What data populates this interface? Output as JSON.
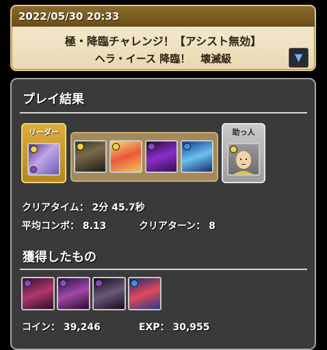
{
  "header": {
    "datetime": "2022/05/30 20:33",
    "title": "極・降臨チャレンジ！【アシスト無効】",
    "subtitle": "ヘラ・イース 降臨！　壊滅級",
    "dropdown_icon": "triangle-down-icon"
  },
  "result": {
    "section_title": "プレイ結果",
    "leader_label": "リーダー",
    "helper_label": "助っ人",
    "clear_time_label": "クリアタイム：",
    "clear_time": "2分 45.7秒",
    "avg_combo_label": "平均コンボ：",
    "avg_combo": "8.13",
    "clear_turns_label": "クリアターン：",
    "clear_turns": "8"
  },
  "team": {
    "leader": {
      "name": "leader-monster",
      "attr_color": "#f0d23a",
      "sub_color": "#8a46c8"
    },
    "subs": [
      {
        "name": "sub-monster-1",
        "attr_color": "#f0d23a",
        "sub_color": "#f0d23a"
      },
      {
        "name": "sub-monster-2",
        "attr_color": "#f0d23a",
        "sub_color": "#f0d23a"
      },
      {
        "name": "sub-monster-3",
        "attr_color": "#8a46c8",
        "sub_color": "#8a46c8"
      },
      {
        "name": "sub-monster-4",
        "attr_color": "#3a8ee8",
        "sub_color": "#f0d23a"
      }
    ],
    "helper": {
      "name": "helper-monster",
      "attr_color": "#f0d23a",
      "sub_color": "#f0d23a"
    }
  },
  "rewards": {
    "section_title": "獲得したもの",
    "coin_label": "コイン：",
    "coin": "39,246",
    "exp_label": "EXP：",
    "exp": "30,955",
    "drops": [
      {
        "name": "drop-monster-1",
        "attr_color": "#8a46c8"
      },
      {
        "name": "drop-monster-2",
        "attr_color": "#8a46c8"
      },
      {
        "name": "drop-monster-3",
        "attr_color": "#8a46c8"
      },
      {
        "name": "drop-monster-4",
        "attr_color": "#3a8ee8"
      }
    ]
  },
  "colors": {
    "banner_dark": "#6b4d18",
    "panel_bg": "#3a3a3a",
    "leader_gold": "#dcae3c",
    "helper_silver": "#b4b4b4"
  }
}
